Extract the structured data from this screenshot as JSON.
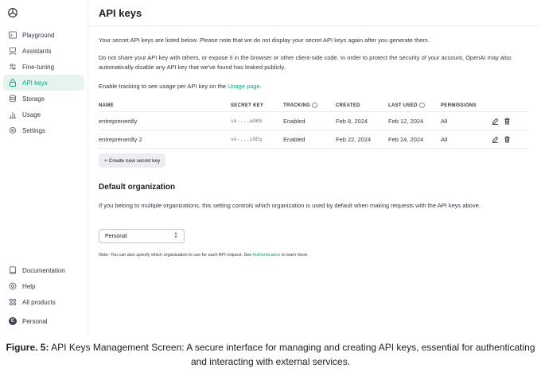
{
  "sidebar": {
    "items": [
      {
        "label": "Playground",
        "icon": "terminal-icon"
      },
      {
        "label": "Assistants",
        "icon": "robot-icon"
      },
      {
        "label": "Fine-tuning",
        "icon": "sliders-icon"
      },
      {
        "label": "API keys",
        "icon": "lock-icon",
        "active": true
      },
      {
        "label": "Storage",
        "icon": "database-icon"
      },
      {
        "label": "Usage",
        "icon": "bar-chart-icon"
      },
      {
        "label": "Settings",
        "icon": "gear-icon"
      }
    ],
    "bottom": [
      {
        "label": "Documentation",
        "icon": "document-icon"
      },
      {
        "label": "Help",
        "icon": "help-icon"
      },
      {
        "label": "All products",
        "icon": "grid-icon"
      }
    ],
    "account": {
      "avatar_letter": "C",
      "label": "Personal"
    }
  },
  "main": {
    "title": "API keys",
    "intro": "Your secret API keys are listed below. Please note that we do not display your secret API keys again after you generate them.",
    "warning": "Do not share your API key with others, or expose it in the browser or other client-side code. In order to protect the security of your account, OpenAI may also automatically disable any API key that we've found has leaked publicly.",
    "tracking_prefix": "Enable tracking to see usage per API key on the ",
    "tracking_link": "Usage page",
    "tracking_suffix": ".",
    "table": {
      "headers": {
        "name": "NAME",
        "secret_key": "SECRET KEY",
        "tracking": "TRACKING",
        "created": "CREATED",
        "last_used": "LAST USED",
        "permissions": "PERMISSIONS"
      },
      "rows": [
        {
          "name": "entreprenerdly",
          "secret_key": "sk-...aOKN",
          "tracking": "Enabled",
          "created": "Feb 8, 2024",
          "last_used": "Feb 12, 2024",
          "permissions": "All"
        },
        {
          "name": "entreprenerdly 2",
          "secret_key": "sk-...i9Eq",
          "tracking": "Enabled",
          "created": "Feb 22, 2024",
          "last_used": "Feb 24, 2024",
          "permissions": "All"
        }
      ]
    },
    "create_button": "+ Create new secret key",
    "default_org": {
      "title": "Default organization",
      "description": "If you belong to multiple organizations, this setting controls which organization is used by default when making requests with the API keys above.",
      "selected": "Personal",
      "note_prefix": "Note: You can also specify which organization to use for each API request. See ",
      "note_link": "Authentication",
      "note_suffix": " to learn more."
    }
  },
  "caption": {
    "label": "Figure. 5:",
    "text": " API Keys Management Screen: A secure interface for managing and creating API keys, essential for authenticating and interacting with external services."
  },
  "colors": {
    "accent": "#10a37f",
    "active_bg": "#e7f3ef",
    "border": "#ececf1"
  }
}
